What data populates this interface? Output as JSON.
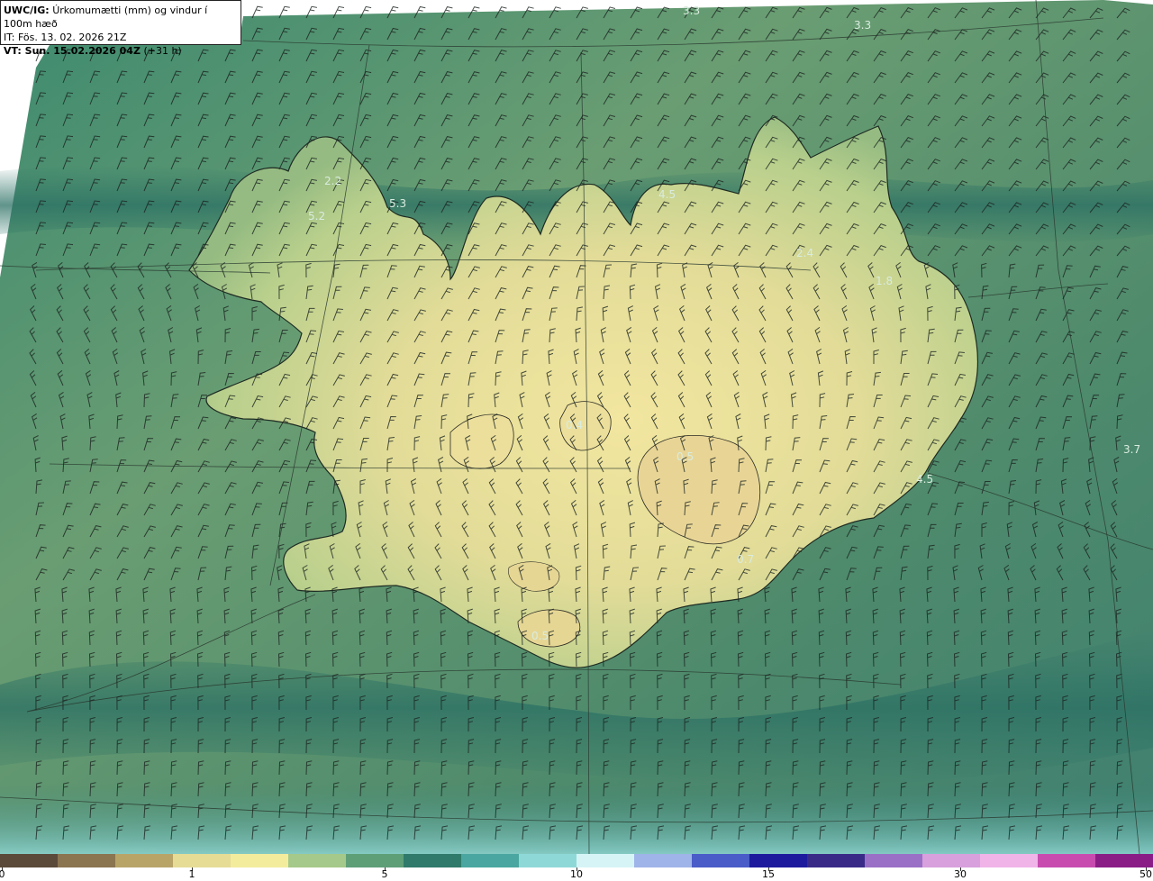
{
  "header": {
    "model": "UWC/IG:",
    "title": "Úrkomumætti (mm) og vindur í 100m hæð",
    "init_time": "IT: Fös. 13. 02. 2026 21Z",
    "valid_time_prefix": "VT: Sun. 15.02.2026 04Z",
    "valid_offset": "(+31 h)"
  },
  "map_labels": [
    "3.3",
    "3.3",
    "2.2",
    "5.3",
    "5.2",
    "4.5",
    "2.4",
    "1.8",
    "3.7",
    "4.5",
    "0.4",
    "0.5",
    "0.7",
    "0.5"
  ],
  "legend": {
    "ticks": [
      {
        "label": "0",
        "value": 0
      },
      {
        "label": "1",
        "value": 1
      },
      {
        "label": "5",
        "value": 5
      },
      {
        "label": "10",
        "value": 10
      },
      {
        "label": "15",
        "value": 15
      },
      {
        "label": "30",
        "value": 30
      },
      {
        "label": "50",
        "value": 50
      }
    ],
    "colors": [
      "#5b4a3a",
      "#8b7550",
      "#b9a468",
      "#e6dc96",
      "#f3ec9c",
      "#a5c98a",
      "#5e9f78",
      "#2f7a6a",
      "#4aa6a0",
      "#8fd8d8",
      "#d6f4f6",
      "#9fb4e8",
      "#4a5cc8",
      "#1e1a9e",
      "#3a2a88",
      "#9a70c6",
      "#d8a0dc",
      "#f0b4e8",
      "#c84cb0",
      "#8a1e86"
    ]
  },
  "colors": {
    "sea_dark": "#2f6d58",
    "sea_mid": "#5f9a6d",
    "land_low": "#b9cc8a",
    "land_high": "#f1e7a2",
    "coast": "#1e2b22",
    "barb": "#1b2420"
  }
}
